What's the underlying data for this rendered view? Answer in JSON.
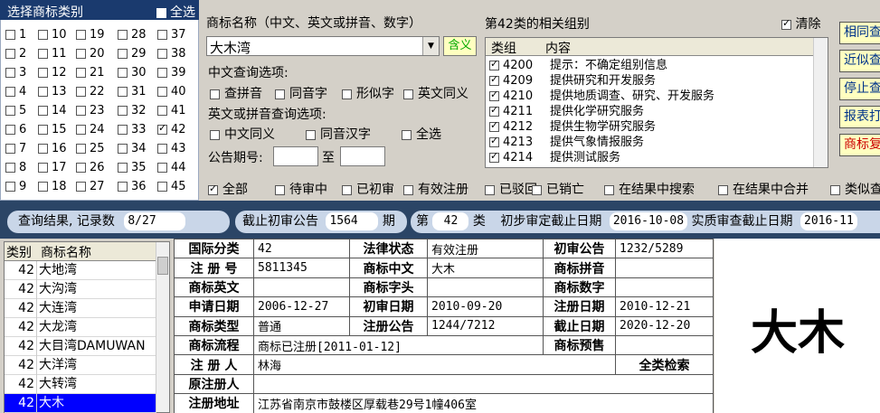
{
  "category_panel": {
    "title": "选择商标类别",
    "select_all": "全选",
    "categories": [
      {
        "num": "1",
        "checked": false
      },
      {
        "num": "10",
        "checked": false
      },
      {
        "num": "19",
        "checked": false
      },
      {
        "num": "28",
        "checked": false
      },
      {
        "num": "37",
        "checked": false
      },
      {
        "num": "2",
        "checked": false
      },
      {
        "num": "11",
        "checked": false
      },
      {
        "num": "20",
        "checked": false
      },
      {
        "num": "29",
        "checked": false
      },
      {
        "num": "38",
        "checked": false
      },
      {
        "num": "3",
        "checked": false
      },
      {
        "num": "12",
        "checked": false
      },
      {
        "num": "21",
        "checked": false
      },
      {
        "num": "30",
        "checked": false
      },
      {
        "num": "39",
        "checked": false
      },
      {
        "num": "4",
        "checked": false
      },
      {
        "num": "13",
        "checked": false
      },
      {
        "num": "22",
        "checked": false
      },
      {
        "num": "31",
        "checked": false
      },
      {
        "num": "40",
        "checked": false
      },
      {
        "num": "5",
        "checked": false
      },
      {
        "num": "14",
        "checked": false
      },
      {
        "num": "23",
        "checked": false
      },
      {
        "num": "32",
        "checked": false
      },
      {
        "num": "41",
        "checked": false
      },
      {
        "num": "6",
        "checked": false
      },
      {
        "num": "15",
        "checked": false
      },
      {
        "num": "24",
        "checked": false
      },
      {
        "num": "33",
        "checked": false
      },
      {
        "num": "42",
        "checked": true
      },
      {
        "num": "7",
        "checked": false
      },
      {
        "num": "16",
        "checked": false
      },
      {
        "num": "25",
        "checked": false
      },
      {
        "num": "34",
        "checked": false
      },
      {
        "num": "43",
        "checked": false
      },
      {
        "num": "8",
        "checked": false
      },
      {
        "num": "17",
        "checked": false
      },
      {
        "num": "26",
        "checked": false
      },
      {
        "num": "35",
        "checked": false
      },
      {
        "num": "44",
        "checked": false
      },
      {
        "num": "9",
        "checked": false
      },
      {
        "num": "18",
        "checked": false
      },
      {
        "num": "27",
        "checked": false
      },
      {
        "num": "36",
        "checked": false
      },
      {
        "num": "45",
        "checked": false
      }
    ]
  },
  "search": {
    "name_label": "商标名称（中文、英文或拼音、数字）",
    "name_value": "大木湾",
    "meaning_button": "含义",
    "cn_options_label": "中文查询选项:",
    "cn_options": [
      {
        "label": "查拼音",
        "checked": false
      },
      {
        "label": "同音字",
        "checked": false
      },
      {
        "label": "形似字",
        "checked": false
      },
      {
        "label": "英文同义",
        "checked": false
      }
    ],
    "en_options_label": "英文或拼音查询选项:",
    "en_options": [
      {
        "label": "中文同义",
        "checked": false
      },
      {
        "label": "同音汉字",
        "checked": false
      },
      {
        "label": "全选",
        "checked": false
      }
    ],
    "period_label": "公告期号:",
    "period_to": "至"
  },
  "group_panel": {
    "title": "第42类的相关组别",
    "clear_label": "清除",
    "clear_checked": true,
    "col_group": "类组",
    "col_content": "内容",
    "rows": [
      {
        "code": "4200",
        "text": "提示：不确定组别信息",
        "checked": true
      },
      {
        "code": "4209",
        "text": "提供研究和开发服务",
        "checked": true
      },
      {
        "code": "4210",
        "text": "提供地质调查、研究、开发服务",
        "checked": true
      },
      {
        "code": "4211",
        "text": "提供化学研究服务",
        "checked": true
      },
      {
        "code": "4212",
        "text": "提供生物学研究服务",
        "checked": true
      },
      {
        "code": "4213",
        "text": "提供气象情报服务",
        "checked": true
      },
      {
        "code": "4214",
        "text": "提供测试服务",
        "checked": true
      }
    ]
  },
  "right_buttons": [
    "相同查",
    "近似查",
    "停止查",
    "报表打",
    "商标复"
  ],
  "filters": [
    {
      "label": "全部",
      "checked": true
    },
    {
      "label": "待审中",
      "checked": false
    },
    {
      "label": "已初审",
      "checked": false
    },
    {
      "label": "有效注册",
      "checked": false
    },
    {
      "label": "已驳回",
      "checked": false
    },
    {
      "label": "已销亡",
      "checked": false
    },
    {
      "label": "在结果中搜索",
      "checked": false
    },
    {
      "label": "在结果中合并",
      "checked": false
    },
    {
      "label": "类似查",
      "checked": false
    }
  ],
  "status_bar": {
    "result_label": "查询结果, 记录数",
    "result_value": "8/27",
    "cutoff_label": "截止初审公告",
    "cutoff_value": "1564",
    "cutoff_unit": "期",
    "class_prefix": "第",
    "class_value": "42",
    "class_suffix": "类",
    "prelim_label": "初步审定截止日期",
    "prelim_value": "2016-10-08",
    "substantive_label": "实质审查截止日期",
    "substantive_value": "2016-11"
  },
  "result_list": {
    "col_class": "类别",
    "col_name": "商标名称",
    "rows": [
      {
        "cls": "42",
        "name": "大地湾",
        "selected": false
      },
      {
        "cls": "42",
        "name": "大沟湾",
        "selected": false
      },
      {
        "cls": "42",
        "name": "大连湾",
        "selected": false
      },
      {
        "cls": "42",
        "name": "大龙湾",
        "selected": false
      },
      {
        "cls": "42",
        "name": "大目湾DAMUWAN",
        "selected": false
      },
      {
        "cls": "42",
        "name": "大洋湾",
        "selected": false
      },
      {
        "cls": "42",
        "name": "大转湾",
        "selected": false
      },
      {
        "cls": "42",
        "name": "大木",
        "selected": true
      }
    ]
  },
  "detail": {
    "intl_class_label": "国际分类",
    "intl_class": "42",
    "legal_status_label": "法律状态",
    "legal_status": "有效注册",
    "prelim_pub_label": "初审公告",
    "prelim_pub": "1232/5289",
    "reg_no_label": "注 册 号",
    "reg_no": "5811345",
    "name_cn_label": "商标中文",
    "name_cn": "大木",
    "pinyin_label": "商标拼音",
    "pinyin": "",
    "name_en_label": "商标英文",
    "name_en": "",
    "head_label": "商标字头",
    "head": "",
    "digit_label": "商标数字",
    "digit": "",
    "apply_date_label": "申请日期",
    "apply_date": "2006-12-27",
    "prelim_date_label": "初审日期",
    "prelim_date": "2010-09-20",
    "reg_date_label": "注册日期",
    "reg_date": "2010-12-21",
    "type_label": "商标类型",
    "type": "普通",
    "reg_pub_label": "注册公告",
    "reg_pub": "1244/7212",
    "expiry_label": "截止日期",
    "expiry": "2020-12-20",
    "flow_label": "商标流程",
    "flow": "商标已注册[2011-01-12]",
    "preview_label": "商标预售",
    "preview": "",
    "registrant_label": "注 册 人",
    "registrant": "林海",
    "all_class_search": "全类检索",
    "orig_registrant_label": "原注册人",
    "orig_registrant": "",
    "address_label": "注册地址",
    "address": "江苏省南京市鼓楼区厚载巷29号1幢406室"
  },
  "mark_image_text": "大木"
}
